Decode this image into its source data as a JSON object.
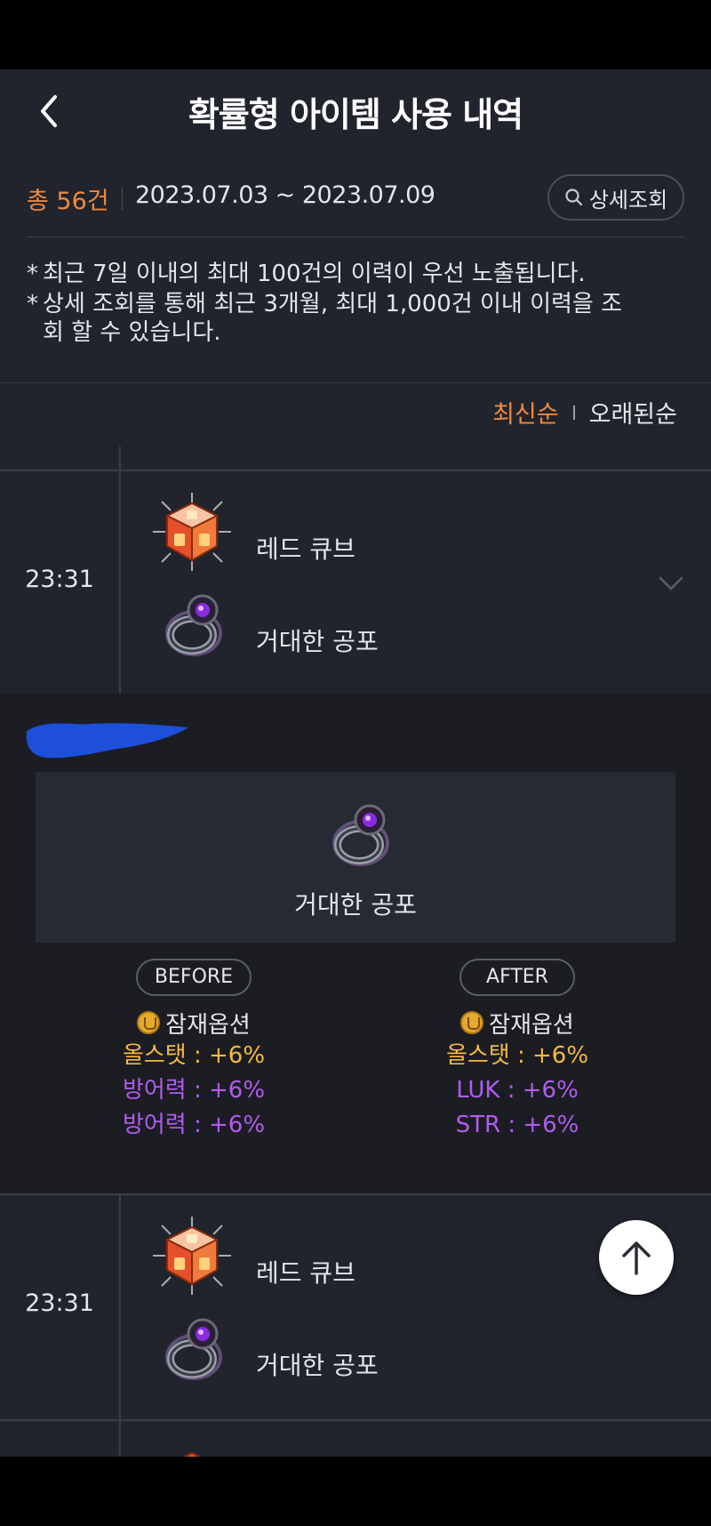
{
  "header": {
    "title": "확률형 아이템 사용 내역"
  },
  "summary": {
    "total": "총 56건",
    "date_range": "2023.07.03 ~ 2023.07.09",
    "detail_button": "상세조회"
  },
  "notes": [
    "최근 7일 이내의 최대 100건의 이력이 우선 노출됩니다.",
    "상세 조회를 통해 최근 3개월, 최대 1,000건 이내 이력을 조",
    "회 할 수 있습니다."
  ],
  "sort": {
    "latest": "최신순",
    "oldest": "오래된순"
  },
  "rows": [
    {
      "time": "23:31",
      "cube": "레드 큐브",
      "item": "거대한 공포"
    },
    {
      "time": "23:31",
      "cube": "레드 큐브",
      "item": "거대한 공포"
    }
  ],
  "detail": {
    "item_name": "거대한 공포",
    "before": {
      "label": "BEFORE",
      "potential_label": "잠재옵션",
      "options": [
        "올스탯 : +6%",
        "방어력 : +6%",
        "방어력 : +6%"
      ]
    },
    "after": {
      "label": "AFTER",
      "potential_label": "잠재옵션",
      "options": [
        "올스탯 : +6%",
        "LUK : +6%",
        "STR : +6%"
      ]
    }
  },
  "colors": {
    "accent_orange": "#f0883e",
    "option_gold": "#f5b944",
    "option_purple": "#b15cf0",
    "background": "#21242c"
  },
  "icons": [
    "chevron-left-icon",
    "search-icon",
    "red-cube-icon",
    "ring-icon",
    "chevron-down-icon",
    "potential-coin-icon",
    "arrow-up-icon"
  ]
}
